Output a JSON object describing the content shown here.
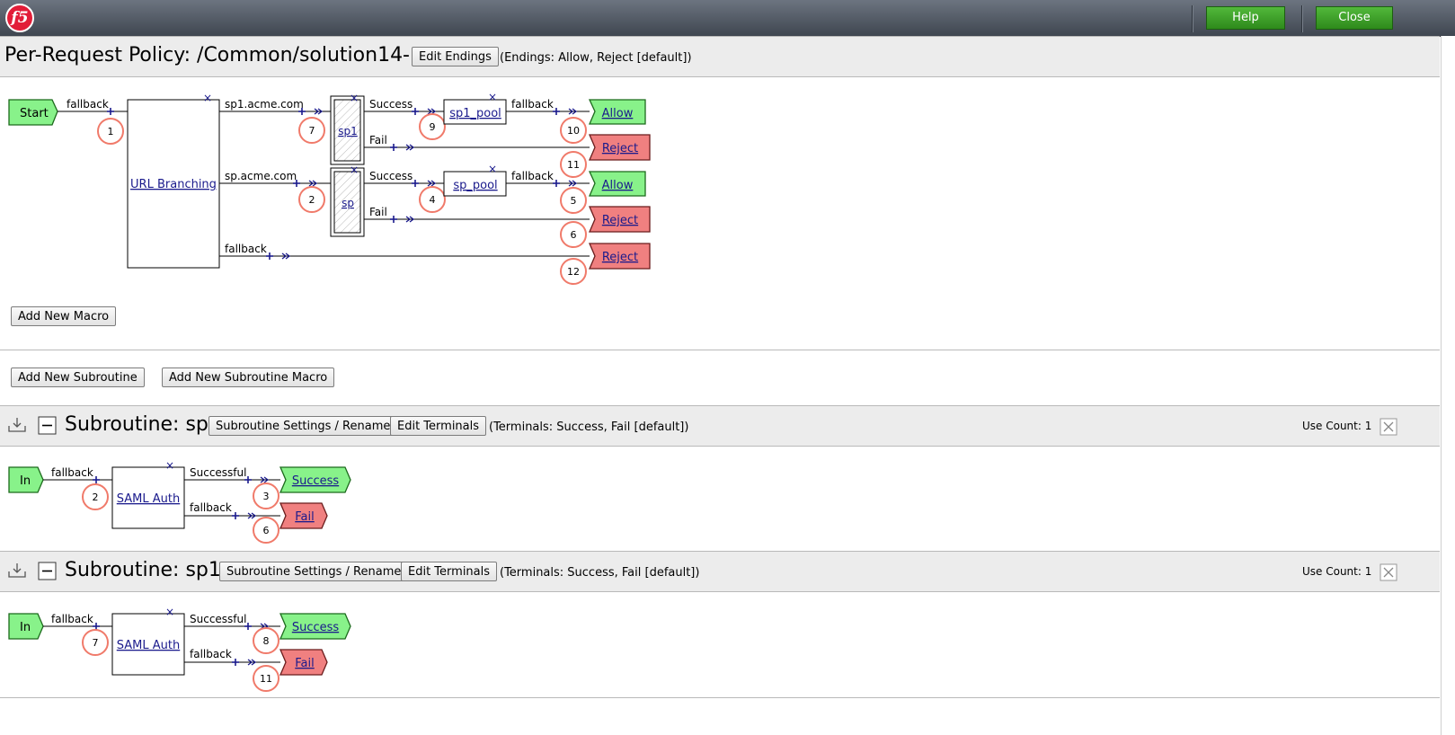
{
  "topbar": {
    "logo": "f5",
    "help_label": "Help",
    "close_label": "Close"
  },
  "policy": {
    "title": "Per-Request Policy: /Common/solution14-prp",
    "edit_endings_label": "Edit Endings",
    "endings_note": "(Endings: Allow, Reject [default])",
    "add_macro_label": "Add New Macro",
    "add_subroutine_label": "Add New Subroutine",
    "add_subroutine_macro_label": "Add New Subroutine Macro",
    "flow": {
      "start": "Start",
      "fallback1": "fallback",
      "url_branching": "URL Branching",
      "branch1": "sp1.acme.com",
      "branch2": "sp.acme.com",
      "branch3": "fallback",
      "sp1": "sp1",
      "sp": "sp",
      "success1": "Success",
      "fail1": "Fail",
      "success2": "Success",
      "fail2": "Fail",
      "sp1_pool": "sp1_pool",
      "sp_pool": "sp_pool",
      "pool_fallback1": "fallback",
      "pool_fallback2": "fallback",
      "allow": "Allow",
      "reject": "Reject",
      "n1": "1",
      "n7": "7",
      "n9": "9",
      "n10": "10",
      "n11": "11",
      "n2": "2",
      "n4": "4",
      "n5": "5",
      "n6": "6",
      "n12": "12"
    }
  },
  "subroutines": [
    {
      "title": "Subroutine: sp",
      "settings_label": "Subroutine Settings / Rename",
      "edit_terminals_label": "Edit Terminals",
      "terminals_note": "(Terminals: Success, Fail [default])",
      "use_count": "Use Count: 1",
      "flow": {
        "in": "In",
        "fallback": "fallback",
        "saml": "SAML Auth",
        "successful": "Successful",
        "fallback2": "fallback",
        "success": "Success",
        "fail": "Fail",
        "na": "2",
        "nb": "3",
        "nc": "6"
      }
    },
    {
      "title": "Subroutine: sp1",
      "settings_label": "Subroutine Settings / Rename",
      "edit_terminals_label": "Edit Terminals",
      "terminals_note": "(Terminals: Success, Fail [default])",
      "use_count": "Use Count: 1",
      "flow": {
        "in": "In",
        "fallback": "fallback",
        "saml": "SAML Auth",
        "successful": "Successful",
        "fallback2": "fallback",
        "success": "Success",
        "fail": "Fail",
        "na": "7",
        "nb": "8",
        "nc": "11"
      }
    }
  ],
  "colors": {
    "green_terminal": "#88f28a",
    "red_terminal": "#f08080",
    "circle": "#f07a6a",
    "link": "#1a1a8c",
    "button_green": "#3a9e25"
  },
  "icons": [
    "f5-logo",
    "plus-icon",
    "arrow-icon",
    "close-x-icon",
    "collapse-icon",
    "move-icon",
    "delete-icon"
  ]
}
